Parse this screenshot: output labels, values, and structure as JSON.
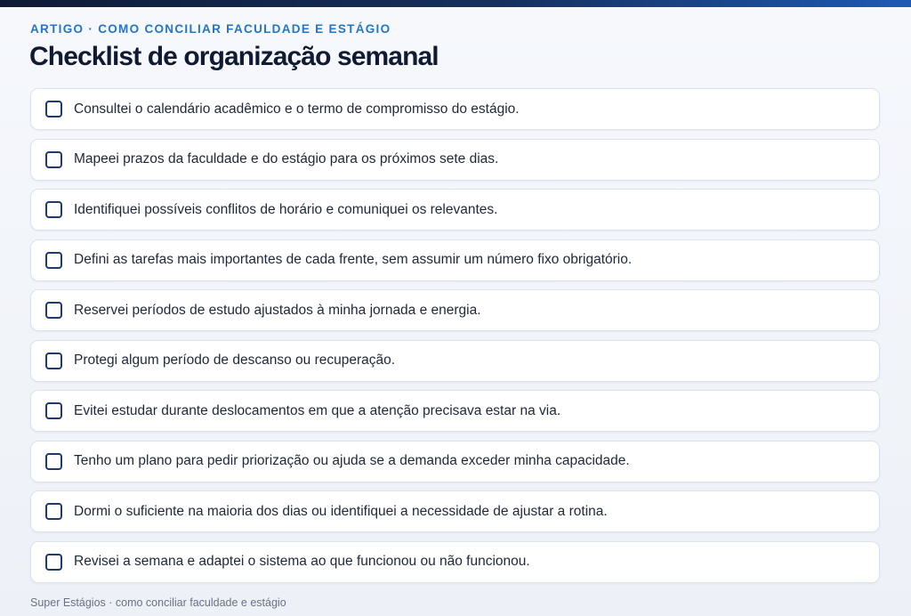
{
  "header": {
    "eyebrow": "ARTIGO · COMO CONCILIAR FACULDADE E ESTÁGIO",
    "title": "Checklist de organização semanal"
  },
  "checklist": {
    "items": [
      {
        "label": "Consultei o calendário acadêmico e o termo de compromisso do estágio.",
        "checked": false
      },
      {
        "label": "Mapeei prazos da faculdade e do estágio para os próximos sete dias.",
        "checked": false
      },
      {
        "label": "Identifiquei possíveis conflitos de horário e comuniquei os relevantes.",
        "checked": false
      },
      {
        "label": "Defini as tarefas mais importantes de cada frente, sem assumir um número fixo obrigatório.",
        "checked": false
      },
      {
        "label": "Reservei períodos de estudo ajustados à minha jornada e energia.",
        "checked": false
      },
      {
        "label": "Protegi algum período de descanso ou recuperação.",
        "checked": false
      },
      {
        "label": "Evitei estudar durante deslocamentos em que a atenção precisava estar na via.",
        "checked": false
      },
      {
        "label": "Tenho um plano para pedir priorização ou ajuda se a demanda exceder minha capacidade.",
        "checked": false
      },
      {
        "label": "Dormi o suficiente na maioria dos dias ou identifiquei a necessidade de ajustar a rotina.",
        "checked": false
      },
      {
        "label": "Revisei a semana e adaptei o sistema ao que funcionou ou não funcionou.",
        "checked": false
      }
    ]
  },
  "footer": {
    "note": "Super Estágios · como conciliar faculdade e estágio"
  },
  "colors": {
    "accent": "#2376c9",
    "title": "#101a33",
    "checkbox_border": "#1d3a6e",
    "top_bar_start": "#0f1b36",
    "top_bar_end": "#1e5ab4"
  }
}
